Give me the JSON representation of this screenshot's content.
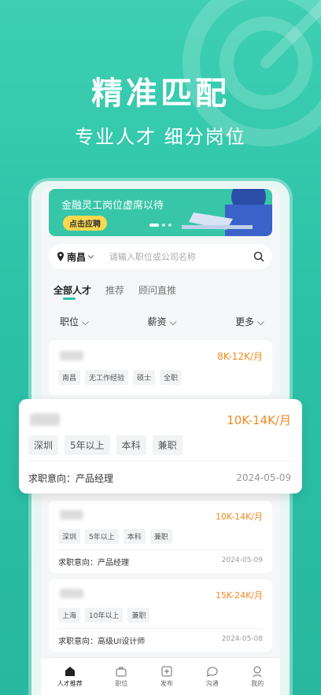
{
  "headline": "精准匹配",
  "subline": "专业人才  细分岗位",
  "banner": {
    "text": "金融灵工岗位虚席以待",
    "button": "点击应聘"
  },
  "search": {
    "city": "南昌",
    "placeholder": "请输入职位或公司名称"
  },
  "tabs": [
    "全部人才",
    "推荐",
    "顾问直推"
  ],
  "filters": [
    "职位",
    "薪资",
    "更多"
  ],
  "cards": [
    {
      "salary": "8K-12K/月",
      "tags": [
        "南昌",
        "无工作经验",
        "硕士",
        "全职"
      ]
    },
    {
      "salary": "10K-14K/月",
      "tags": [
        "深圳",
        "5年以上",
        "本科",
        "兼职"
      ],
      "intent": "求职意向：产品经理",
      "date": "2024-05-09"
    },
    {
      "salary": "15K-24K/月",
      "tags": [
        "上海",
        "10年以上",
        "兼职"
      ],
      "intent": "求职意向：高级UI设计师",
      "date": "2024-05-08"
    }
  ],
  "highlight": {
    "salary": "10K-14K/月",
    "tags": [
      "深圳",
      "5年以上",
      "本科",
      "兼职"
    ],
    "intent": "求职意向：产品经理",
    "date": "2024-05-09"
  },
  "nav": [
    "人才推荐",
    "职位",
    "发布",
    "沟通",
    "我的"
  ],
  "colors": {
    "accent": "#2cc3a8",
    "salary": "#f08a24"
  }
}
